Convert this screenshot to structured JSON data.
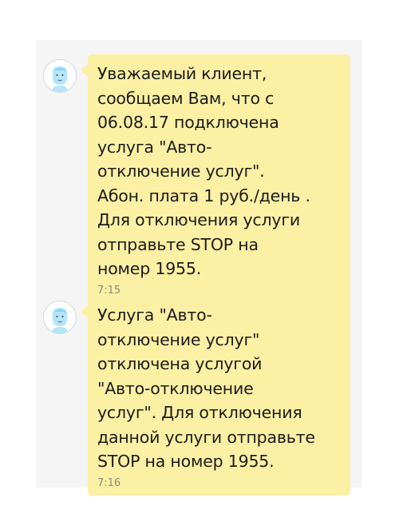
{
  "conversation": {
    "messages": [
      {
        "avatar_icon": "default-contact-avatar-icon",
        "text": "Уважаемый клиент,\nсообщаем Вам, что с\n06.08.17 подключена\nуслуга \"Авто-\nотключение услуг\".\nАбон. плата 1 руб./день .\nДля отключения услуги\nотправьте STOP на\nномер 1955.",
        "time": "7:15"
      },
      {
        "avatar_icon": "default-contact-avatar-icon",
        "text": "Услуга \"Авто-\nотключение услуг\"\nотключена услугой\n\"Авто-отключение\nуслуг\". Для отключения\nданной услуги отправьте\nSTOP на номер 1955.",
        "time": "7:16"
      }
    ]
  },
  "colors": {
    "bubble_background": "#fcf0a5",
    "chat_background": "#f5f5f5",
    "avatar_accent": "#b3e5fc"
  }
}
